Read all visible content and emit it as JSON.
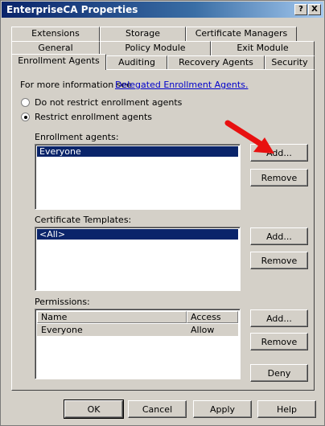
{
  "window": {
    "title": "EnterpriseCA Properties",
    "help_glyph": "?",
    "close_glyph": "X"
  },
  "tabs": {
    "row1": [
      "Extensions",
      "Storage",
      "Certificate Managers"
    ],
    "row2": [
      "General",
      "Policy Module",
      "Exit Module"
    ],
    "row3": [
      "Enrollment Agents",
      "Auditing",
      "Recovery Agents",
      "Security"
    ],
    "active": "Enrollment Agents"
  },
  "info": {
    "prefix": "For more information see",
    "link": "Delegated Enrollment Agents."
  },
  "restriction": {
    "options": [
      "Do not restrict enrollment agents",
      "Restrict enrollment agents"
    ],
    "selected": "Restrict enrollment agents"
  },
  "enrollment_agents": {
    "label": "Enrollment agents:",
    "items": [
      "Everyone"
    ],
    "add_label": "Add...",
    "remove_label": "Remove"
  },
  "certificate_templates": {
    "label": "Certificate Templates:",
    "items": [
      "<All>"
    ],
    "add_label": "Add...",
    "remove_label": "Remove"
  },
  "permissions": {
    "label": "Permissions:",
    "columns": [
      "Name",
      "Access"
    ],
    "rows": [
      {
        "name": "Everyone",
        "access": "Allow"
      }
    ],
    "add_label": "Add...",
    "remove_label": "Remove",
    "deny_label": "Deny"
  },
  "footer": {
    "ok": "OK",
    "cancel": "Cancel",
    "apply": "Apply",
    "help": "Help"
  },
  "colors": {
    "title_bar": "#0a246a",
    "face": "#d4d0c8",
    "selection": "#0a246a",
    "link": "#0000cc",
    "arrow": "#e81010"
  }
}
